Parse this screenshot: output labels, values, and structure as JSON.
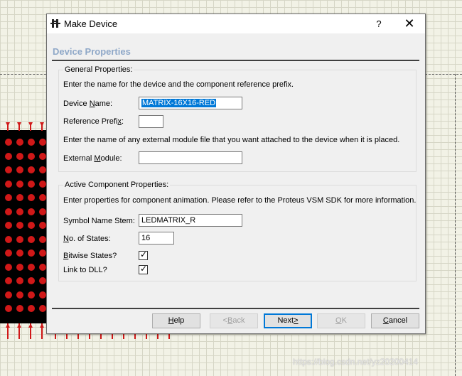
{
  "dialog": {
    "title": "Make Device",
    "help_glyph": "?",
    "close_glyph": "✕",
    "section_heading": "Device Properties"
  },
  "general": {
    "title": "General Properties:",
    "instruction": "Enter the name for the device and the component reference prefix.",
    "device_name_label_pre": "Device ",
    "device_name_label_u": "N",
    "device_name_label_post": "ame:",
    "device_name_value": "MATRIX-16X16-RED",
    "reference_prefix_label_pre": "Reference Prefi",
    "reference_prefix_label_u": "x",
    "reference_prefix_label_post": ":",
    "reference_prefix_value": "",
    "module_instruction": "Enter the name of any external module file that you want attached to the device when it is placed.",
    "external_module_label_pre": "External ",
    "external_module_label_u": "M",
    "external_module_label_post": "odule:",
    "external_module_value": ""
  },
  "active": {
    "title": "Active Component Properties:",
    "instruction": "Enter properties for component animation. Please refer to the Proteus VSM SDK for more information.",
    "symbol_stem_label": "Symbol Name Stem:",
    "symbol_stem_value": "LEDMATRIX_R",
    "states_label_u": "N",
    "states_label_post": "o. of States:",
    "states_value": "16",
    "bitwise_label_u": "B",
    "bitwise_label_post": "itwise States?",
    "bitwise_checked": true,
    "dll_label": "Link to DLL?",
    "dll_checked": true,
    "check_glyph": "✓"
  },
  "buttons": {
    "help_u": "H",
    "help_post": "elp",
    "back_pre": "<",
    "back_u": "B",
    "back_post": "ack",
    "next_pre": "Next",
    "next_u": ">",
    "ok_u": "O",
    "ok_post": "K",
    "cancel_u": "C",
    "cancel_post": "ancel"
  },
  "watermark": "https://blog.csdn.net/yz20200414",
  "colors": {
    "heading": "#8fa8c8",
    "led": "#d01818",
    "selection": "#0078d7"
  }
}
